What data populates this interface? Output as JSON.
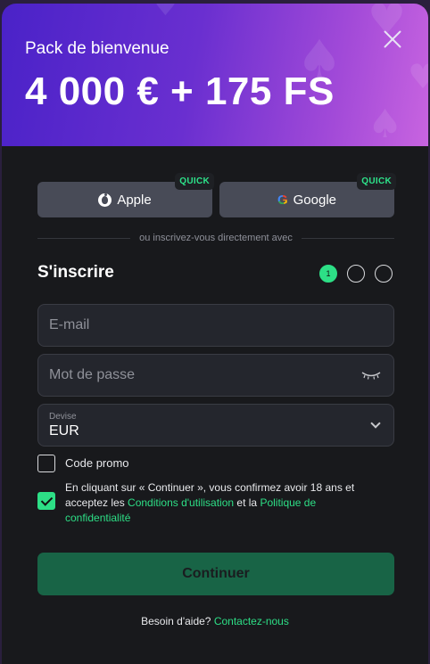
{
  "banner": {
    "subtitle": "Pack de bienvenue",
    "title": "4 000 € + 175 FS"
  },
  "social": {
    "apple_label": "Apple",
    "google_label": "Google",
    "quick_badge": "QUICK"
  },
  "divider_text": "ou inscrivez-vous directement avec",
  "form": {
    "title": "S'inscrire",
    "steps": [
      "1",
      "",
      ""
    ],
    "email_placeholder": "E-mail",
    "email_value": "",
    "password_placeholder": "Mot de passe",
    "password_value": "",
    "currency_label": "Devise",
    "currency_value": "EUR",
    "promo_label": "Code promo",
    "promo_checked": false,
    "terms_checked": true,
    "terms_text_1": "En cliquant sur « Continuer », vous confirmez avoir 18 ans et acceptez les ",
    "terms_link_1": "Conditions d'utilisation",
    "terms_text_2": " et la ",
    "terms_link_2": "Politique de confidentialité",
    "continue_label": "Continuer"
  },
  "help": {
    "text": "Besoin d'aide? ",
    "link": "Contactez-nous"
  },
  "colors": {
    "accent": "#2ddf86",
    "button_bg": "#186446",
    "field_bg": "#24262d",
    "modal_bg": "#18191c"
  }
}
